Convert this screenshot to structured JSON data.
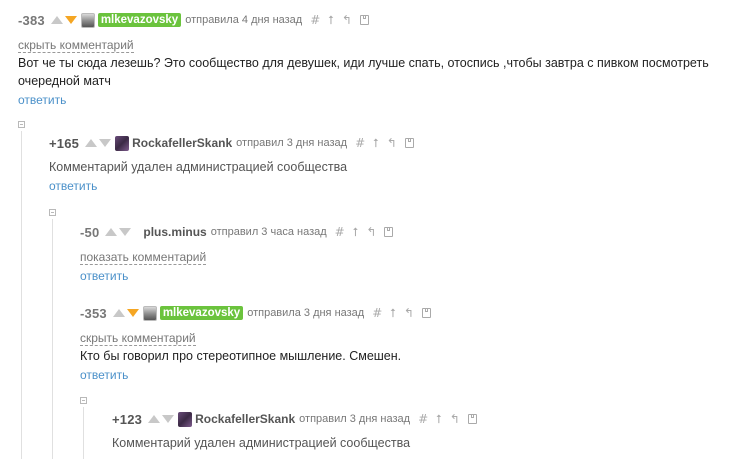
{
  "comments": [
    {
      "rating": "-383",
      "author": "mlkevazovsky",
      "meta": "отправила 4 дня назад",
      "toggle_label": "скрыть комментарий",
      "text": "Вот че ты сюда лезешь? Это сообщество для девушек, иди лучше спать, отоспись ,чтобы завтра с пивком посмотреть очередной матч",
      "reply_label": "ответить",
      "icons": {
        "hash": "#",
        "up": "⭡",
        "parent": "↰"
      }
    },
    {
      "rating": "+165",
      "author": "RockafellerSkank",
      "meta": "отправил 3 дня назад",
      "text": "Комментарий удален администрацией сообщества",
      "reply_label": "ответить"
    },
    {
      "rating": "-50",
      "author": "plus.minus",
      "meta": "отправил 3 часа назад",
      "toggle_label": "показать комментарий",
      "reply_label": "ответить"
    },
    {
      "rating": "-353",
      "author": "mlkevazovsky",
      "meta": "отправила 3 дня назад",
      "toggle_label": "скрыть комментарий",
      "text": "Кто бы говорил про стереотипное мышление. Смешен.",
      "reply_label": "ответить"
    },
    {
      "rating": "+123",
      "author": "RockafellerSkank",
      "meta": "отправил 3 дня назад",
      "text": "Комментарий удален администрацией сообщества"
    }
  ],
  "icon_glyphs": {
    "hash": "#",
    "up": "⭡",
    "parent": "↰"
  },
  "colors": {
    "author_badge": "#6bc33d",
    "vote_down_active": "#f5a623",
    "reply_link": "#4a90c9"
  }
}
